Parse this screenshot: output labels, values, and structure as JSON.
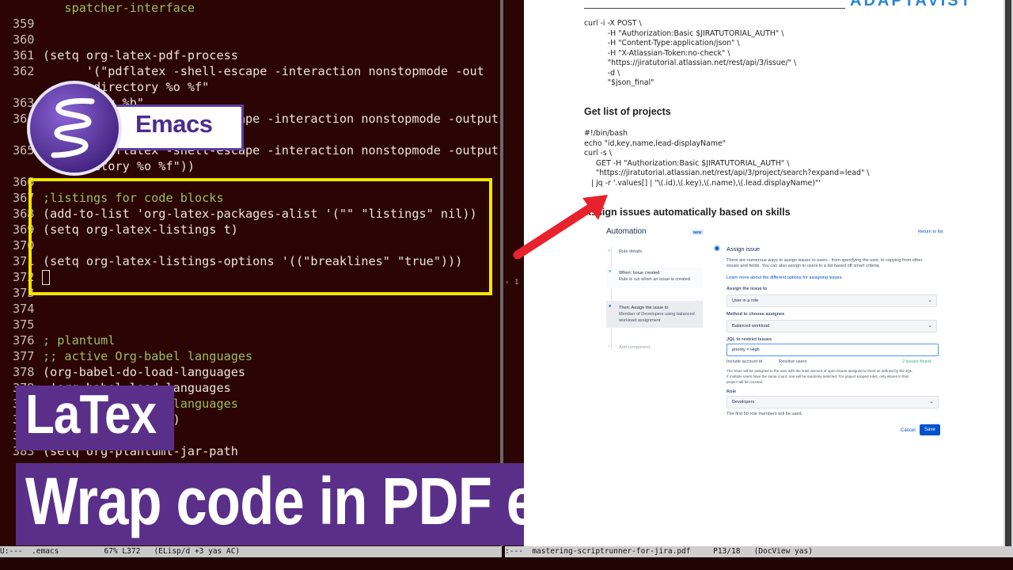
{
  "editor": {
    "lines": [
      {
        "num": "",
        "text": "   spatcher-interface",
        "kind": "plain"
      },
      {
        "num": "359",
        "text": "",
        "kind": "code"
      },
      {
        "num": "360",
        "text": "",
        "kind": "code"
      },
      {
        "num": "361",
        "text": "(setq org-latex-pdf-process",
        "kind": "code"
      },
      {
        "num": "362",
        "text": "      '(\"pdflatex -shell-escape -interaction nonstopmode -out",
        "kind": "code"
      },
      {
        "num": "",
        "text": "   put-directory %o %f\"",
        "kind": "code"
      },
      {
        "num": "363",
        "text": "     latex %b\"",
        "kind": "code"
      },
      {
        "num": "364",
        "text": "        pdflatex -shell-escape -interaction nonstopmode -output-",
        "kind": "code"
      },
      {
        "num": "",
        "text": "",
        "kind": "code"
      },
      {
        "num": "365",
        "text": "        pdflatex -shell-escape -interaction nonstopmode -output-",
        "kind": "code"
      },
      {
        "num": "",
        "text": "   directory %o %f\"))",
        "kind": "code"
      },
      {
        "num": "366",
        "text": "",
        "kind": "code"
      },
      {
        "num": "367",
        "text": ";listings for code blocks",
        "kind": "comment"
      },
      {
        "num": "368",
        "text": "(add-to-list 'org-latex-packages-alist '(\"\" \"listings\" nil))",
        "kind": "code"
      },
      {
        "num": "369",
        "text": "(setq org-latex-listings t)",
        "kind": "code"
      },
      {
        "num": "370",
        "text": "",
        "kind": "code"
      },
      {
        "num": "371",
        "text": "(setq org-latex-listings-options '((\"breaklines\" \"true\")))",
        "kind": "code"
      },
      {
        "num": "372",
        "text": "",
        "kind": "code"
      },
      {
        "num": "373",
        "text": "",
        "kind": "code"
      },
      {
        "num": "374",
        "text": "",
        "kind": "code"
      },
      {
        "num": "375",
        "text": "",
        "kind": "code"
      },
      {
        "num": "376",
        "text": "; plantuml",
        "kind": "comment"
      },
      {
        "num": "377",
        "text": ";; active Org-babel languages",
        "kind": "comment"
      },
      {
        "num": "378",
        "text": "(org-babel-do-load-languages",
        "kind": "code"
      },
      {
        "num": "379",
        "text": " 'org-babel-load-languages",
        "kind": "code"
      },
      {
        "num": "380",
        "text": " '(;; other Babel languages",
        "kind": "comment"
      },
      {
        "num": "381",
        "text": "   (plantuml . t)))",
        "kind": "code"
      },
      {
        "num": "382",
        "text": "",
        "kind": "code"
      },
      {
        "num": "383",
        "text": "(setq org-plantuml-jar-path",
        "kind": "code"
      }
    ]
  },
  "badge": {
    "label": "Emacs"
  },
  "banners": {
    "topic": "LaTex",
    "title": "Wrap code in PDF export"
  },
  "modeline_left": "U:---  .emacs          67% L372   (ELisp/d +3 yas AC)",
  "modeline_right": ":---  mastering-scriptrunner-for-jira.pdf     P13/18   (DocView yas)",
  "fringe": {
    "arrow": "‹",
    "page": "1"
  },
  "pdf": {
    "logo": "ADAPTAVIST",
    "code_block_1": "curl -i -X POST \\\n          -H \"Authorization:Basic $JIRATUTORIAL_AUTH\" \\\n          -H \"Content-Type:application/json\" \\\n          -H \"X-Atlassian-Token:no-check\" \\\n          \"https://jiratutorial.atlassian.net/rest/api/3/issue/\" \\\n          -d \\\n          \"$json_final\"",
    "heading_projects": "Get list of projects",
    "code_block_2": "#!/bin/bash\necho \"id,key,name,lead-displayName\"\ncurl -s \\\n     GET -H \"Authorization:Basic $JIRATUTORIAL_AUTH\" \\\n     \"https://jiratutorial.atlassian.net/rest/api/3/project/search?expand=lead\" \\\n   | jq -r '.values[] | \"\\(.id),\\(.key),\\(.name),\\(.lead.displayName)\"'",
    "heading_assign": "Assign issues automatically based on skills"
  },
  "jira": {
    "title": "Automation",
    "new_badge": "NEW",
    "return_link": "Return to list",
    "rule_details": "Rule details",
    "when_title": "When: Issue created",
    "when_sub": "Rule is run when an issue is created.",
    "then_title": "Then: Assign the issue to",
    "then_sub1": "Member of Developers using balanced",
    "then_sub2": "workload assignment",
    "add_component": "Add component",
    "assign_title": "Assign issue",
    "desc1": "There are numerous ways to assign issues to users - from specifying the user, to copying from other",
    "desc2": "issues and fields. You can also assign to users in a list based off smart criteria.",
    "learn_more": "Learn more about the different options for assigning issues.",
    "assign_label": "Assign the issue to",
    "assign_value": "User in a role",
    "method_label": "Method to choose assignee",
    "method_value": "Balanced workload",
    "jql_label": "JQL to restrict issues",
    "jql_value": "priority = High",
    "include_label": "Include account id",
    "resolve_label": "Resolve users",
    "found_label": "2 issues found",
    "note1": "The issue will be assigned to the user with the least amount of open issues assigned to them as defined by the JQL.",
    "note2": "If multiple users have the same count, one will be randomly selected. For project scoped rules, only issues in that",
    "note3": "project will be counted.",
    "role_label": "Role",
    "role_value": "Developers",
    "role_note": "The first 50 role members will be used.",
    "cancel": "Cancel",
    "save": "Save",
    "accent": "#0052cc"
  },
  "colors": {
    "editor_bg": "#2b0404",
    "highlight": "#f4e600",
    "banner": "#5a2f8a",
    "arrow": "#e8222c"
  }
}
